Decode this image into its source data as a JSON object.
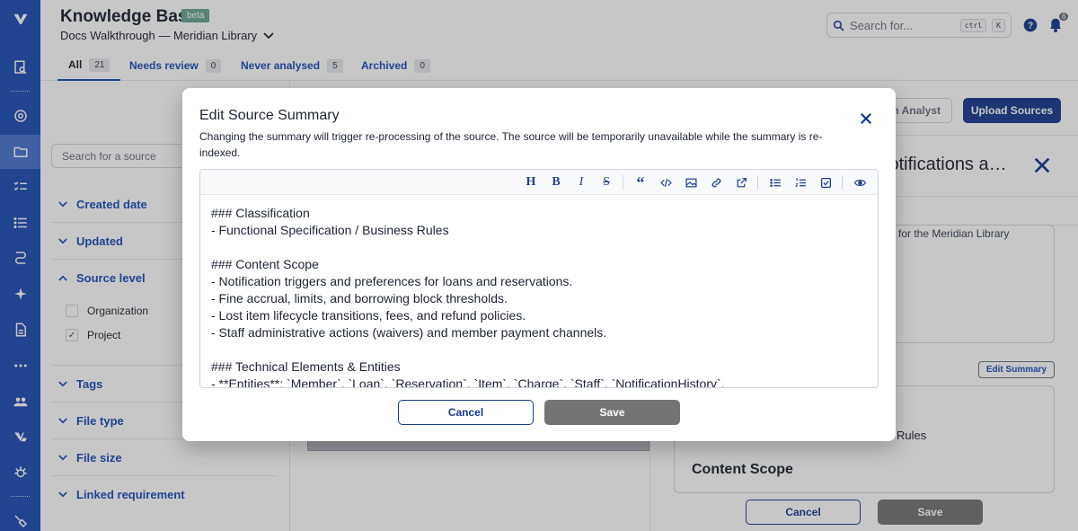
{
  "app": {
    "title": "Knowledge Base",
    "badge": "beta",
    "breadcrumb": "Docs Walkthrough — Meridian Library",
    "search_placeholder": "Search for...",
    "shortcut_keys": [
      "ctrl",
      "K"
    ],
    "notification_count": "6"
  },
  "tabs": [
    {
      "label": "All",
      "count": "21",
      "active": true
    },
    {
      "label": "Needs review",
      "count": "0"
    },
    {
      "label": "Never analysed",
      "count": "5"
    },
    {
      "label": "Archived",
      "count": "0"
    }
  ],
  "sidebar": {
    "search_placeholder": "Search for a source",
    "facets": [
      "Created date",
      "Updated",
      "Source level",
      "Tags",
      "File type",
      "File size",
      "Linked requirement"
    ],
    "source_level_options": [
      {
        "label": "Organization",
        "checked": false
      },
      {
        "label": "Project",
        "checked": true
      }
    ]
  },
  "right_pane": {
    "analyst_button": "n Analyst",
    "upload_button": "Upload Sources",
    "title_fragment": "lotifications a…",
    "text_fragment": "es for the Meridian Library",
    "edit_summary_button": "Edit Summary",
    "rules_fragment": "Rules",
    "content_scope_heading": "Content Scope",
    "cancel_label": "Cancel",
    "save_label": "Save"
  },
  "modal": {
    "title": "Edit Source Summary",
    "description": "Changing the summary will trigger re-processing of the source. The source will be temporarily unavailable while the summary is re-indexed.",
    "toolbar": [
      "heading-icon",
      "bold-icon",
      "italic-icon",
      "strikethrough-icon",
      "quote-icon",
      "code-icon",
      "image-icon",
      "link-icon",
      "external-link-icon",
      "bullet-list-icon",
      "numbered-list-icon",
      "checklist-icon",
      "preview-icon"
    ],
    "content_lines": [
      "### Classification",
      "- Functional Specification / Business Rules",
      "",
      "### Content Scope",
      "- Notification triggers and preferences for loans and reservations.",
      "- Fine accrual, limits, and borrowing block thresholds.",
      "- Lost item lifecycle transitions, fees, and refund policies.",
      "- Staff administrative actions (waivers) and member payment channels.",
      "",
      "### Technical Elements & Entities",
      "- **Entities**: `Member`, `Loan`, `Reservation`, `Item`, `Charge`, `Staff`, `NotificationHistory`."
    ],
    "cancel_label": "Cancel",
    "save_label": "Save"
  },
  "colors": {
    "rail": "#1f4fb5",
    "primary": "#1a3a8f",
    "save_disabled": "#757575"
  }
}
